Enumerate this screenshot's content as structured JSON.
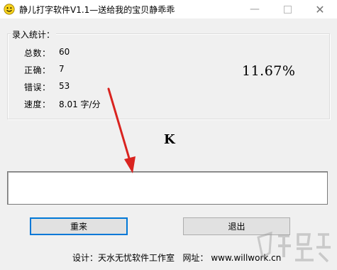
{
  "window": {
    "title": "静儿打字软件V1.1—送给我的宝贝静乖乖",
    "minimize_glyph": "—",
    "close_glyph": "✕"
  },
  "stats": {
    "legend": "录入统计：",
    "total_label": "总数：",
    "total_value": "60",
    "correct_label": "正确：",
    "correct_value": "7",
    "error_label": "错误：",
    "error_value": "53",
    "speed_label": "速度：",
    "speed_value": "8.01 字/分",
    "accuracy": "11.67%"
  },
  "target_char": "K",
  "input": {
    "value": ""
  },
  "buttons": {
    "reset": "重来",
    "exit": "退出"
  },
  "footer": {
    "designer_label": "设计：",
    "designer": "天水无忧软件工作室",
    "website_label": "网址：",
    "website": "www.willwork.cn"
  },
  "colors": {
    "arrow": "#d9231f",
    "icon_face": "#f7d21c",
    "focus_border": "#0078d7"
  },
  "icons": {
    "app": "smiley-icon",
    "arrow": "red-annotation-arrow",
    "watermark": "download-site-watermark"
  }
}
